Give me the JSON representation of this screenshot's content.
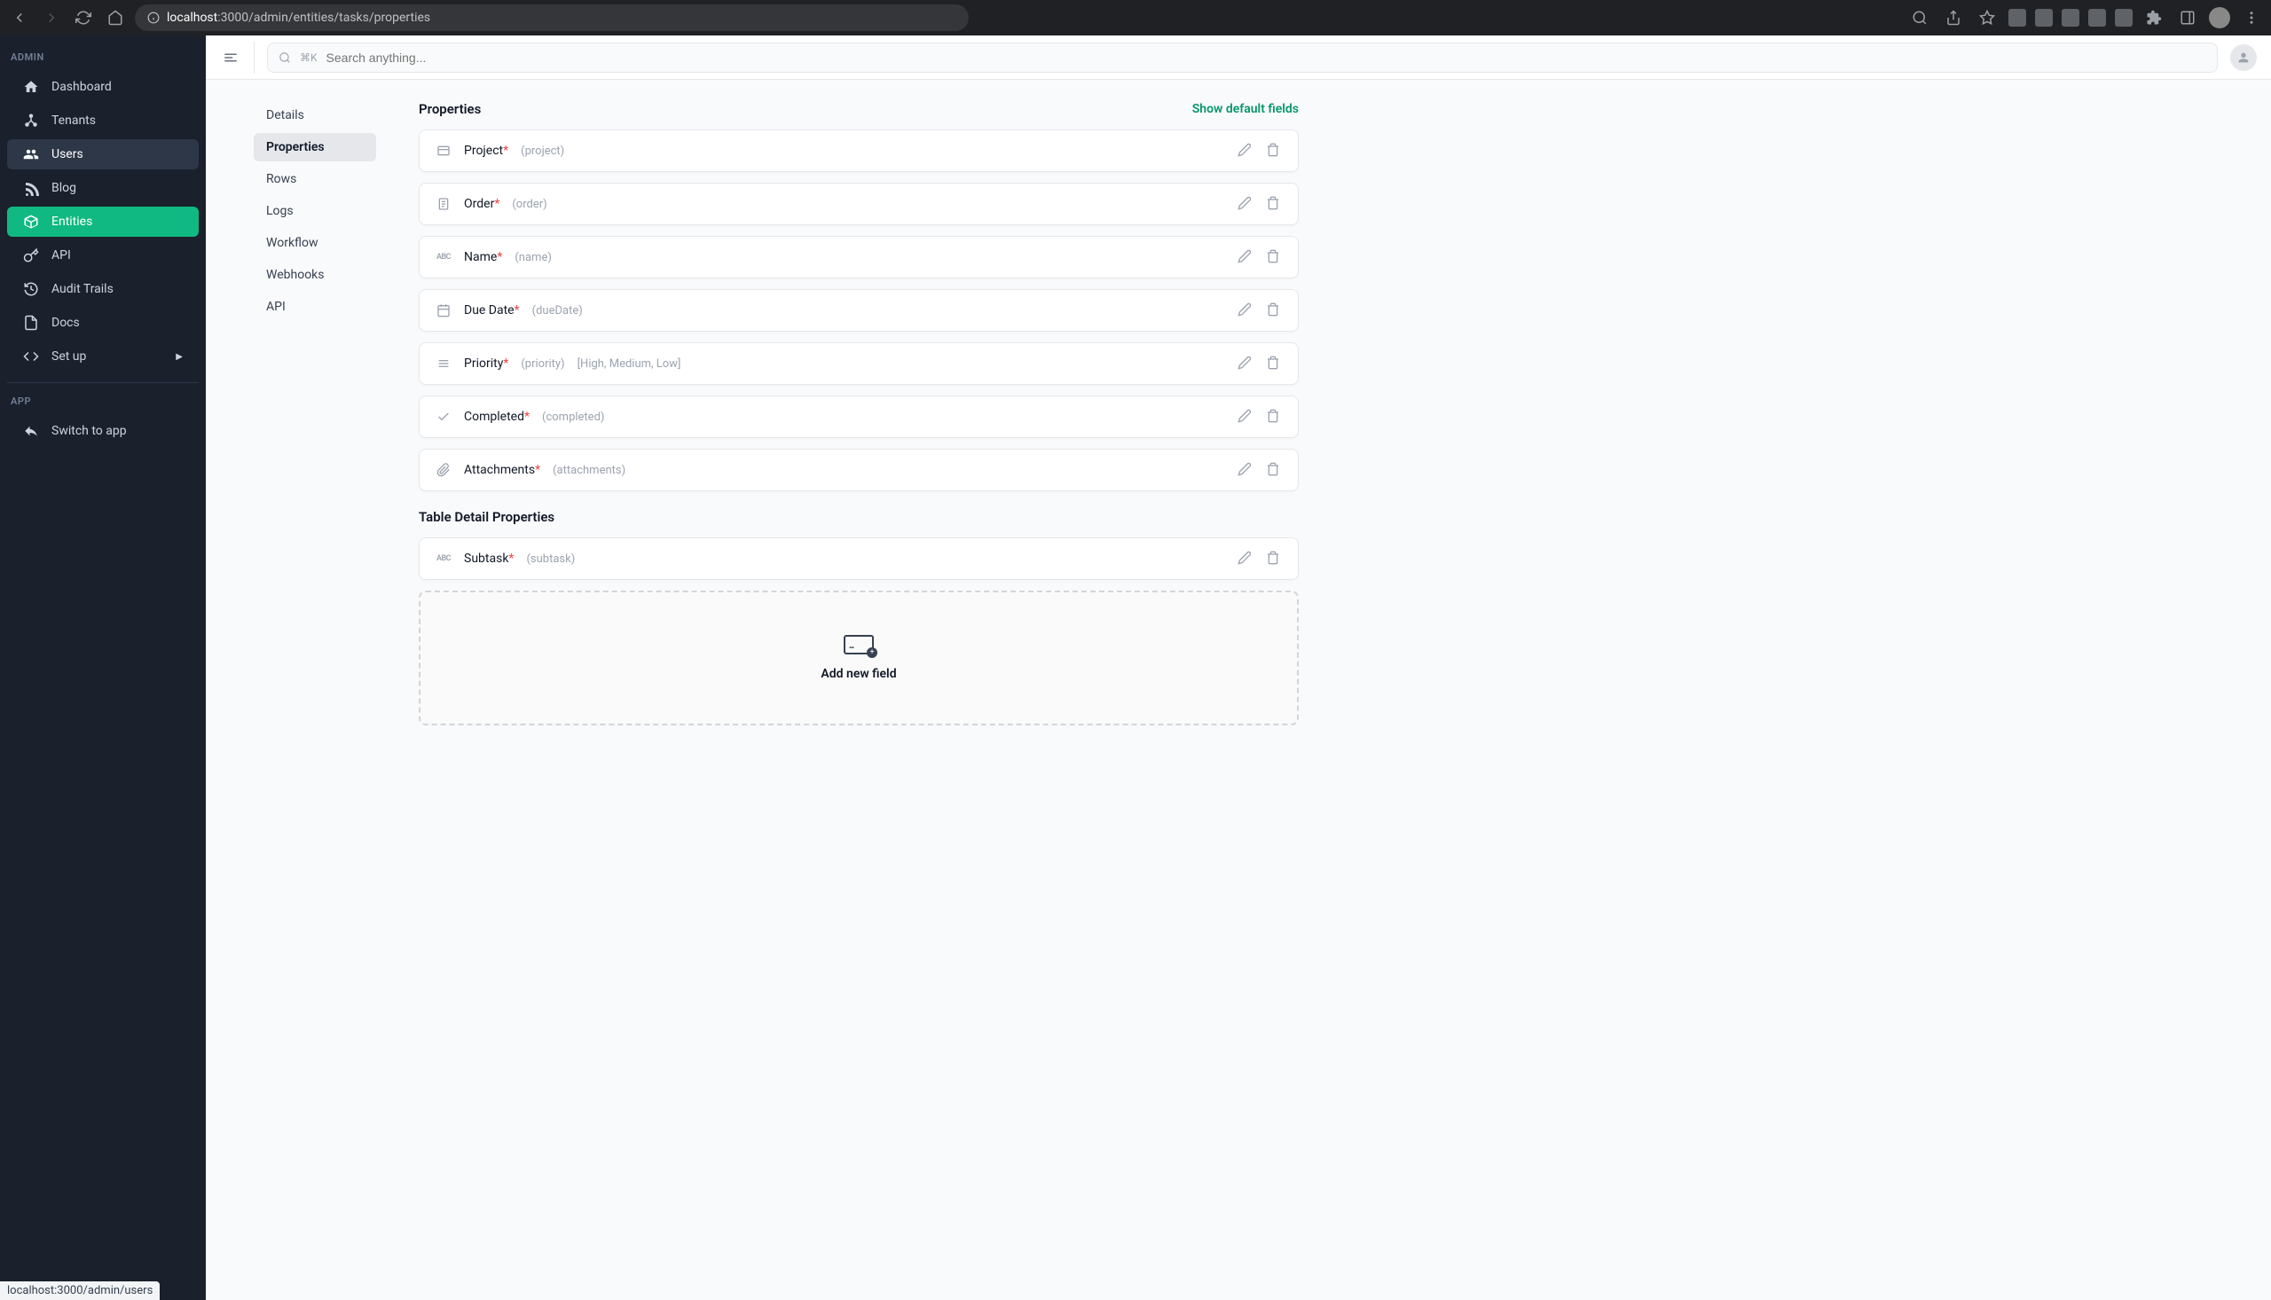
{
  "browser": {
    "url_prefix": "localhost",
    "url_rest": ":3000/admin/entities/tasks/properties",
    "status_url": "localhost:3000/admin/users"
  },
  "sidebar": {
    "admin_label": "ADMIN",
    "app_label": "APP",
    "items": [
      {
        "label": "Dashboard"
      },
      {
        "label": "Tenants"
      },
      {
        "label": "Users"
      },
      {
        "label": "Blog"
      },
      {
        "label": "Entities"
      },
      {
        "label": "API"
      },
      {
        "label": "Audit Trails"
      },
      {
        "label": "Docs"
      },
      {
        "label": "Set up"
      }
    ],
    "switch_label": "Switch to app"
  },
  "topbar": {
    "shortcut": "⌘K",
    "placeholder": "Search anything..."
  },
  "subnav": {
    "items": [
      {
        "label": "Details"
      },
      {
        "label": "Properties"
      },
      {
        "label": "Rows"
      },
      {
        "label": "Logs"
      },
      {
        "label": "Workflow"
      },
      {
        "label": "Webhooks"
      },
      {
        "label": "API"
      }
    ]
  },
  "panel": {
    "title": "Properties",
    "show_default": "Show default fields",
    "detail_title": "Table Detail Properties",
    "add_label": "Add new field"
  },
  "properties": [
    {
      "label": "Project",
      "required": true,
      "slug": "(project)",
      "type": "card"
    },
    {
      "label": "Order",
      "required": true,
      "slug": "(order)",
      "type": "number"
    },
    {
      "label": "Name",
      "required": true,
      "slug": "(name)",
      "type": "text"
    },
    {
      "label": "Due Date",
      "required": true,
      "slug": "(dueDate)",
      "type": "date"
    },
    {
      "label": "Priority",
      "required": true,
      "slug": "(priority)",
      "type": "select",
      "options": "[High, Medium, Low]"
    },
    {
      "label": "Completed",
      "required": true,
      "slug": "(completed)",
      "type": "bool"
    },
    {
      "label": "Attachments",
      "required": true,
      "slug": "(attachments)",
      "type": "attachment"
    }
  ],
  "detail_properties": [
    {
      "label": "Subtask",
      "required": true,
      "slug": "(subtask)",
      "type": "text"
    }
  ]
}
